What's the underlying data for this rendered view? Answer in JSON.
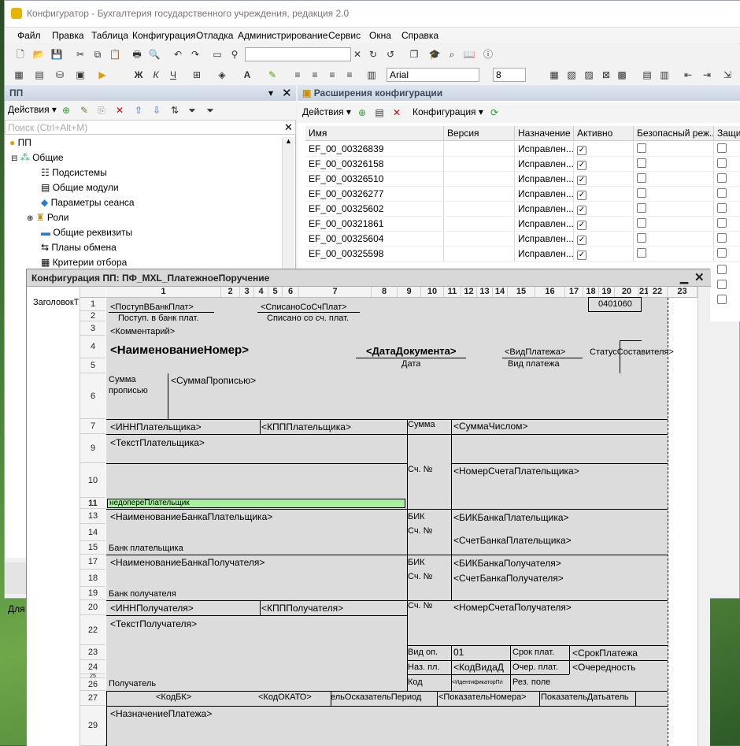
{
  "window": {
    "title": "Конфигуратор - Бухгалтерия государственного учреждения, редакция 2.0"
  },
  "menu": [
    "Файл",
    "Правка",
    "Таблица",
    "Конфигурация",
    "Отладка",
    "Администрирование",
    "Сервис",
    "Окна",
    "Справка"
  ],
  "toolbar": {
    "font": "Arial",
    "size": "8"
  },
  "left_panel": {
    "title": "ПП",
    "actions": "Действия",
    "search_placeholder": "Поиск (Ctrl+Alt+M)",
    "tree": [
      "ПП",
      "Общие",
      "Подсистемы",
      "Общие модули",
      "Параметры сеанса",
      "Роли",
      "Общие реквизиты",
      "Планы обмена",
      "Критерии отбора"
    ],
    "bottom_label": "Для"
  },
  "ext_panel": {
    "title": "Расширения конфигурации",
    "actions": "Действия",
    "config_btn": "Конфигурация",
    "columns": [
      "Имя",
      "Версия",
      "Назначение",
      "Активно",
      "Безопасный реж...",
      "Защита"
    ],
    "rows": [
      {
        "name": "EF_00_00326839",
        "purpose": "Исправлен...",
        "active": true
      },
      {
        "name": "EF_00_00326158",
        "purpose": "Исправлен...",
        "active": true
      },
      {
        "name": "EF_00_00326510",
        "purpose": "Исправлен...",
        "active": true
      },
      {
        "name": "EF_00_00326277",
        "purpose": "Исправлен...",
        "active": true
      },
      {
        "name": "EF_00_00325602",
        "purpose": "Исправлен...",
        "active": true
      },
      {
        "name": "EF_00_00321861",
        "purpose": "Исправлен...",
        "active": true
      },
      {
        "name": "EF_00_00325604",
        "purpose": "Исправлен...",
        "active": true
      },
      {
        "name": "EF_00_00325598",
        "purpose": "Исправлен...",
        "active": true
      }
    ]
  },
  "sheet": {
    "title": "Конфигурация ПП: ПФ_MXL_ПлатежноеПоручение",
    "area_name": "ЗаголовокТ",
    "cols": [
      "1",
      "2",
      "3",
      "4",
      "5",
      "6",
      "7",
      "8",
      "9",
      "10",
      "11",
      "12",
      "13",
      "14",
      "15",
      "16",
      "17",
      "18",
      "19",
      "20",
      "21",
      "22",
      "23"
    ],
    "rows": [
      "1",
      "2",
      "3",
      "4",
      "5",
      "6",
      "7",
      "9",
      "10",
      "11",
      "13",
      "14",
      "15",
      "17",
      "18",
      "19",
      "20",
      "22",
      "23",
      "24",
      "25",
      "26",
      "27",
      "29"
    ],
    "cells": {
      "postup": "<ПоступВБанкПлат>",
      "postup_lbl": "Поступ. в банк плат.",
      "spisano": "<СписаноСоСчПлат>",
      "spisano_lbl": "Списано со сч. плат.",
      "code": "0401060",
      "comment": "<Комментарий>",
      "name_num": "<НаименованиеНомер>",
      "date": "<ДатаДокумента>",
      "date_lbl": "Дата",
      "vid": "<ВидПлатежа>",
      "vid_lbl": "Вид платежа",
      "status": "СтатусСоставителя>",
      "summa_lbl": "Сумма прописью",
      "summa_prop": "<СуммаПрописью>",
      "inn_pl": "<ИННПлательщика>",
      "kpp_pl": "<КПППлательщика>",
      "summa": "Сумма",
      "summa_num": "<СуммаЧислом>",
      "text_pl": "<ТекстПлательщика>",
      "sch_no": "Сч. №",
      "nomer_sch_pl": "<НомерСчетаПлательщика>",
      "highlight": "недопереПлательщик",
      "bank_pl": "<НаименованиеБанкаПлательщика>",
      "bik": "БИК",
      "bik_pl": "<БИКБанкаПлательщика>",
      "sch_no2": "Сч. №",
      "sch_bank_pl": "<СчетБанкаПлательщика>",
      "bank_pl_lbl": "Банк плательщика",
      "bank_pol": "<НаименованиеБанкаПолучателя>",
      "bik2": "БИК",
      "bik_pol": "<БИКБанкаПолучателя>",
      "sch_no3": "Сч. №",
      "sch_bank_pol": "<СчетБанкаПолучателя>",
      "bank_pol_lbl": "Банк получателя",
      "inn_pol": "<ИННПолучателя>",
      "kpp_pol": "<КПППолучателя>",
      "sch_no4": "Сч. №",
      "nomer_sch_pol": "<НомерСчетаПолучателя>",
      "text_pol": "<ТекстПолучателя>",
      "vid_op": "Вид оп.",
      "vid_op_val": "01",
      "srok": "Срок плат.",
      "srok_val": "<СрокПлатежа",
      "naz_pl": "Наз. пл.",
      "kod_vida": "<КодВидаД",
      "ocher": "Очер. плат.",
      "ocher_val": "<Очередность",
      "kod": "Код",
      "ident": "<ИдентификаторПл",
      "rez": "Рез. поле",
      "pol_lbl": "Получатель",
      "kbk": "<КодБК>",
      "okato": "<КодОКАТО>",
      "pok_per": "ельОсказательПериод",
      "pok_nom": "<ПоказательНомера>",
      "pok_dat": "ПоказательДатьатель",
      "naznach": "<НазначениеПлатежа>"
    }
  }
}
